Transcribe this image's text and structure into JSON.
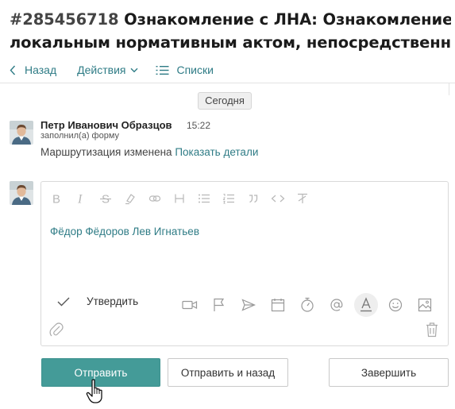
{
  "header": {
    "task_number": "#285456718",
    "title_line1": "Ознакомление с ЛНА: Ознакомление с",
    "title_line2": "локальным нормативным актом, непосредственно св..."
  },
  "toolbar": {
    "back_label": "Назад",
    "actions_label": "Действия",
    "lists_label": "Списки"
  },
  "feed": {
    "date_chip": "Сегодня",
    "entry": {
      "author": "Петр Иванович Образцов",
      "time": "15:22",
      "subline": "заполнил(а) форму",
      "message": "Маршрутизация изменена",
      "details_link": "Показать детали"
    }
  },
  "editor": {
    "format_icons": [
      "bold-icon",
      "italic-icon",
      "strikethrough-icon",
      "highlight-icon",
      "link-icon",
      "heading-icon",
      "bulleted-list-icon",
      "numbered-list-icon",
      "quote-icon",
      "code-icon",
      "clear-format-icon"
    ],
    "content": "Фёдор Фёдоров Лев Игнатьев",
    "approve_label": "Утвердить",
    "action_icons": [
      "video-icon",
      "flag-icon",
      "send-icon",
      "calendar-icon",
      "timer-icon",
      "mention-icon",
      "text-color-icon",
      "emoji-icon",
      "image-icon"
    ]
  },
  "buttons": {
    "send": "Отправить",
    "send_and_back": "Отправить и назад",
    "finish": "Завершить"
  },
  "colors": {
    "accent": "#2f7c86",
    "primary_button": "#449b98"
  }
}
